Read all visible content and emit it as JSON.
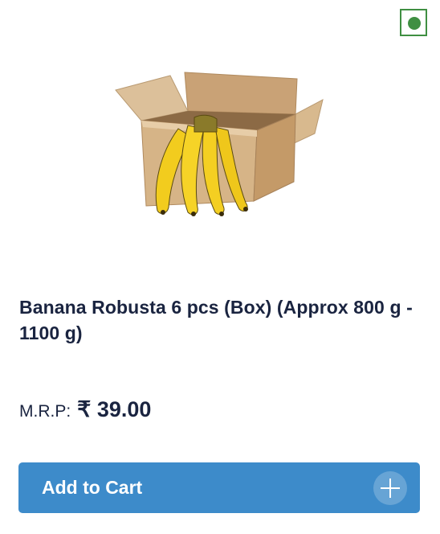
{
  "product": {
    "name": "Banana Robusta 6 pcs (Box) (Approx 800 g - 1100 g)",
    "mrp_label": "M.R.P:",
    "price": "₹ 39.00",
    "image_icon": "banana-box-image",
    "veg_indicator_icon": "veg-indicator-icon"
  },
  "actions": {
    "add_to_cart_label": "Add to Cart",
    "add_icon": "plus-icon"
  },
  "colors": {
    "veg_green": "#3f8f42",
    "title_text": "#1a2440",
    "button_blue": "#3d8bca",
    "button_text": "#ffffff"
  }
}
